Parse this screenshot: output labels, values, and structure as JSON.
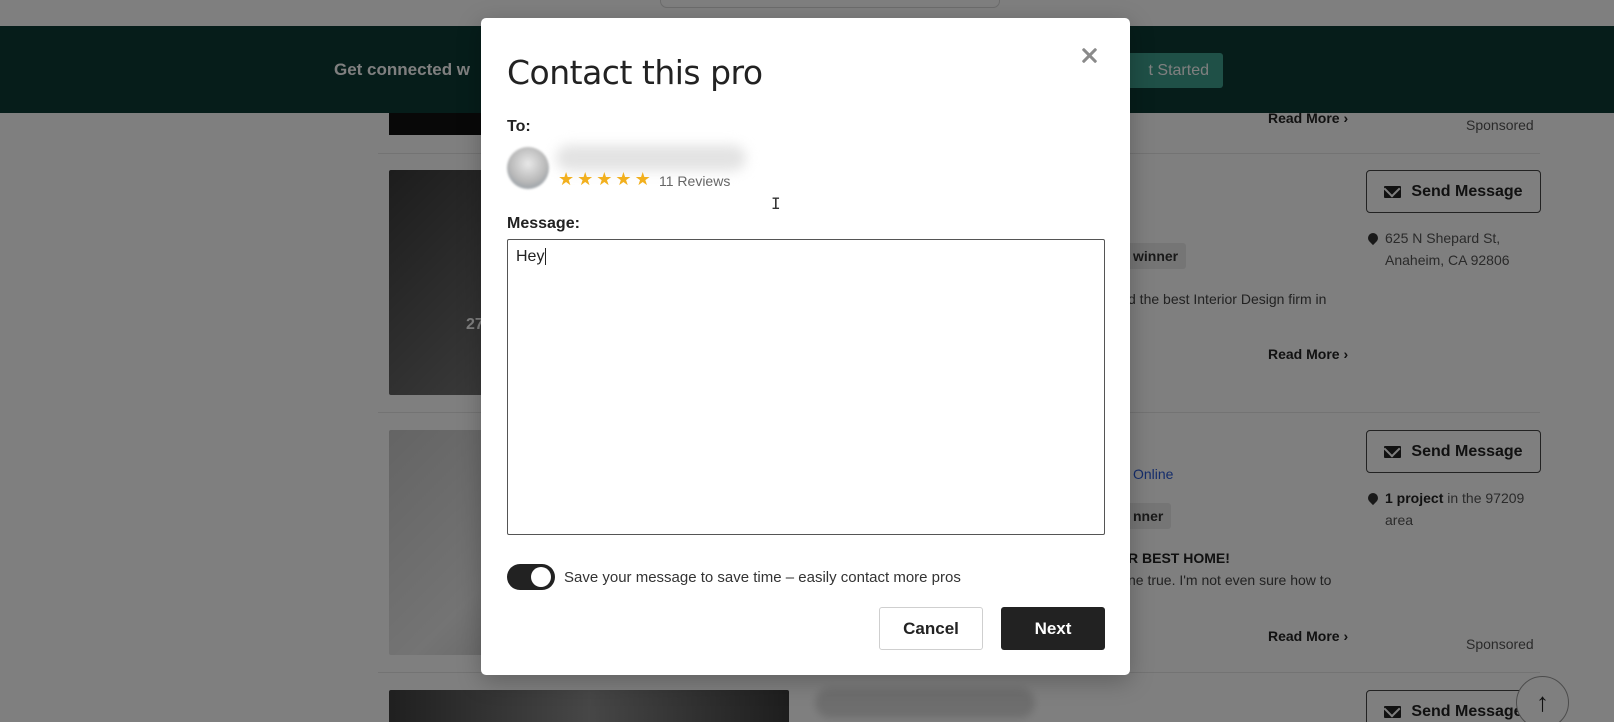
{
  "background": {
    "banner": {
      "text": "Get connected w",
      "button_label": "t Started"
    },
    "listings": [
      {
        "read_more": "Read More",
        "sponsored": "Sponsored"
      },
      {
        "photo_count": "27",
        "send_message": "Send Message",
        "address_line1": "625 N Shepard St,",
        "address_line2": "Anaheim, CA 92806",
        "badge_fragment": "winner",
        "text_fragment": "d the best Interior Design firm in",
        "read_more": "Read More"
      },
      {
        "send_message": "Send Message",
        "location_bold": "1 project",
        "location_rest": " in the 97209",
        "location_line2": "area",
        "online_fragment": "Online",
        "badge_fragment": "nner",
        "headline_fragment": "R BEST HOME!",
        "text_fragment": "ne true. I'm not even sure how to",
        "read_more": "Read More",
        "sponsored": "Sponsored"
      },
      {
        "send_message": "Send Message"
      }
    ],
    "scroll_top_icon": "arrow-up-icon"
  },
  "modal": {
    "title": "Contact this pro",
    "to_label": "To:",
    "rating_stars": 5,
    "reviews": "11 Reviews",
    "message_label": "Message:",
    "message_value": "Hey",
    "save_toggle_on": true,
    "save_toggle_label": "Save your message to save time – easily contact more pros",
    "cancel_label": "Cancel",
    "next_label": "Next"
  },
  "colors": {
    "banner_bg": "#0d3b35",
    "banner_button": "#3fa18e",
    "star": "#f2b01e",
    "primary_button": "#222222",
    "online_link": "#2a5bd7"
  }
}
